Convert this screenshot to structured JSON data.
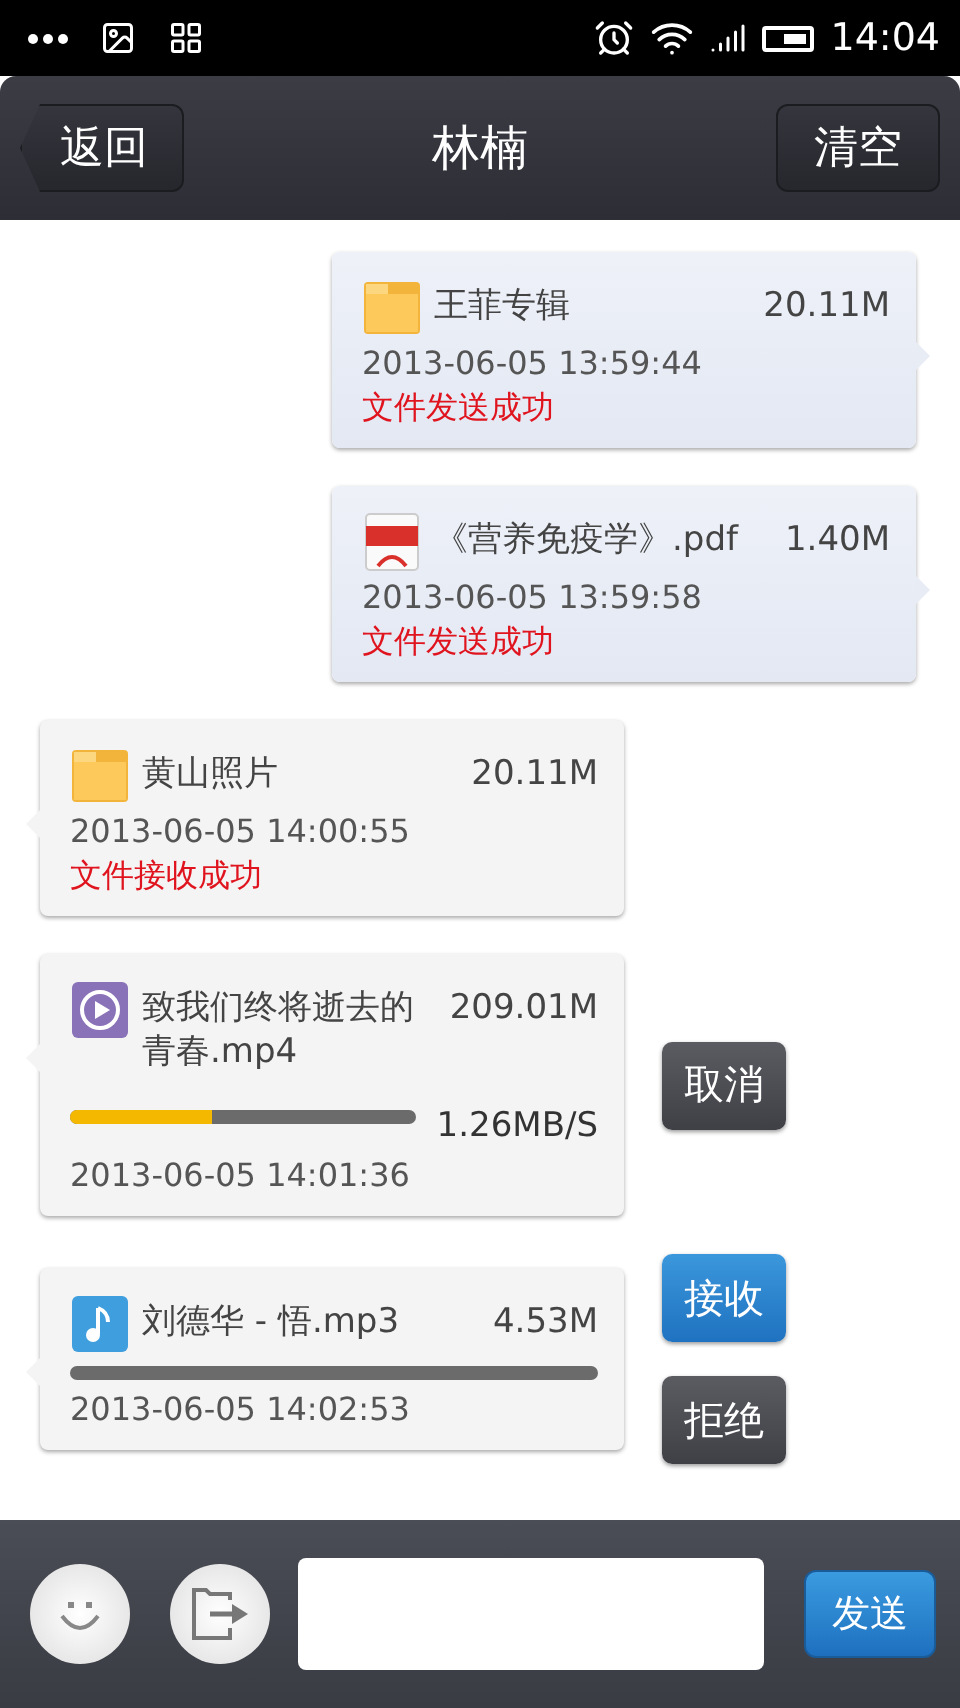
{
  "status_bar": {
    "time": "14:04"
  },
  "header": {
    "back": "返回",
    "title": "林楠",
    "clear": "清空"
  },
  "messages": [
    {
      "kind": "sent",
      "file": {
        "kind": "folder",
        "name": "王菲专辑",
        "size": "20.11M"
      },
      "time": "2013-06-05 13:59:44",
      "status": "文件发送成功"
    },
    {
      "kind": "sent",
      "file": {
        "kind": "pdf",
        "name": "《营养免疫学》.pdf",
        "size": "1.40M"
      },
      "time": "2013-06-05 13:59:58",
      "status": "文件发送成功"
    },
    {
      "kind": "received",
      "file": {
        "kind": "folder",
        "name": "黄山照片",
        "size": "20.11M"
      },
      "time": "2013-06-05 14:00:55",
      "status": "文件接收成功"
    },
    {
      "kind": "received",
      "file": {
        "kind": "video",
        "name": "致我们终将逝去的青春.mp4",
        "size": "209.01M"
      },
      "time": "2013-06-05 14:01:36",
      "progress": {
        "kind": "active",
        "level": 0.41,
        "speed": "1.26MB/S"
      },
      "actions": [
        {
          "label": "取消",
          "kind": "gray"
        }
      ]
    },
    {
      "kind": "received",
      "file": {
        "kind": "audio",
        "name": "刘德华 - 悟.mp3",
        "size": "4.53M"
      },
      "time": "2013-06-05 14:02:53",
      "progress": {
        "kind": "queued"
      },
      "actions": [
        {
          "label": "接收",
          "kind": "blue"
        },
        {
          "label": "拒绝",
          "kind": "gray"
        }
      ]
    }
  ],
  "composer": {
    "send": "发送"
  }
}
